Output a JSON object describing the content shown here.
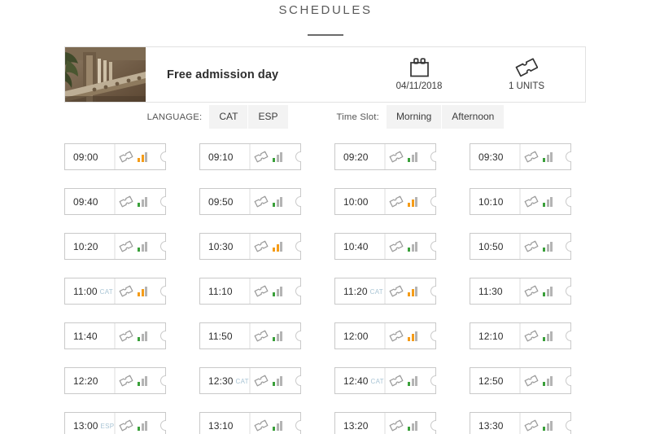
{
  "page": {
    "title": "SCHEDULES"
  },
  "event": {
    "name": "Free admission day",
    "thumbnail_alt": "stone-balustrade-photo",
    "date": {
      "icon": "calendar-icon",
      "value": "04/11/2018"
    },
    "units": {
      "icon": "ticket-icon",
      "value": "1 UNITS"
    }
  },
  "filters": {
    "language": {
      "label": "LANGUAGE:",
      "options": [
        "CAT",
        "ESP"
      ]
    },
    "time_slot": {
      "label": "Time Slot:",
      "options": [
        "Morning",
        "Afternoon"
      ]
    }
  },
  "colors": {
    "availability_high": "#f59c18",
    "availability_low": "#3aa03a",
    "availability_empty": "#b4b4b4",
    "lang_badge": "#a8c4d4",
    "card_border": "#c9c9c9",
    "filter_bg": "#f3f3f3"
  },
  "legend": {
    "availability_note": "bar-chart-icon indicates remaining availability"
  },
  "slots": [
    {
      "time": "09:00",
      "lang": "",
      "availability": "high"
    },
    {
      "time": "09:10",
      "lang": "",
      "availability": "low"
    },
    {
      "time": "09:20",
      "lang": "",
      "availability": "low"
    },
    {
      "time": "09:30",
      "lang": "",
      "availability": "low"
    },
    {
      "time": "09:40",
      "lang": "",
      "availability": "low"
    },
    {
      "time": "09:50",
      "lang": "",
      "availability": "low"
    },
    {
      "time": "10:00",
      "lang": "",
      "availability": "high"
    },
    {
      "time": "10:10",
      "lang": "",
      "availability": "low"
    },
    {
      "time": "10:20",
      "lang": "",
      "availability": "low"
    },
    {
      "time": "10:30",
      "lang": "",
      "availability": "high"
    },
    {
      "time": "10:40",
      "lang": "",
      "availability": "low"
    },
    {
      "time": "10:50",
      "lang": "",
      "availability": "low"
    },
    {
      "time": "11:00",
      "lang": "CAT",
      "availability": "high"
    },
    {
      "time": "11:10",
      "lang": "",
      "availability": "low"
    },
    {
      "time": "11:20",
      "lang": "CAT",
      "availability": "high"
    },
    {
      "time": "11:30",
      "lang": "",
      "availability": "low"
    },
    {
      "time": "11:40",
      "lang": "",
      "availability": "low"
    },
    {
      "time": "11:50",
      "lang": "",
      "availability": "low"
    },
    {
      "time": "12:00",
      "lang": "",
      "availability": "high"
    },
    {
      "time": "12:10",
      "lang": "",
      "availability": "low"
    },
    {
      "time": "12:20",
      "lang": "",
      "availability": "low"
    },
    {
      "time": "12:30",
      "lang": "CAT",
      "availability": "low"
    },
    {
      "time": "12:40",
      "lang": "CAT",
      "availability": "low"
    },
    {
      "time": "12:50",
      "lang": "",
      "availability": "low"
    },
    {
      "time": "13:00",
      "lang": "ESP",
      "availability": "low"
    },
    {
      "time": "13:10",
      "lang": "",
      "availability": "low"
    },
    {
      "time": "13:20",
      "lang": "",
      "availability": "low"
    },
    {
      "time": "13:30",
      "lang": "",
      "availability": "low"
    }
  ]
}
